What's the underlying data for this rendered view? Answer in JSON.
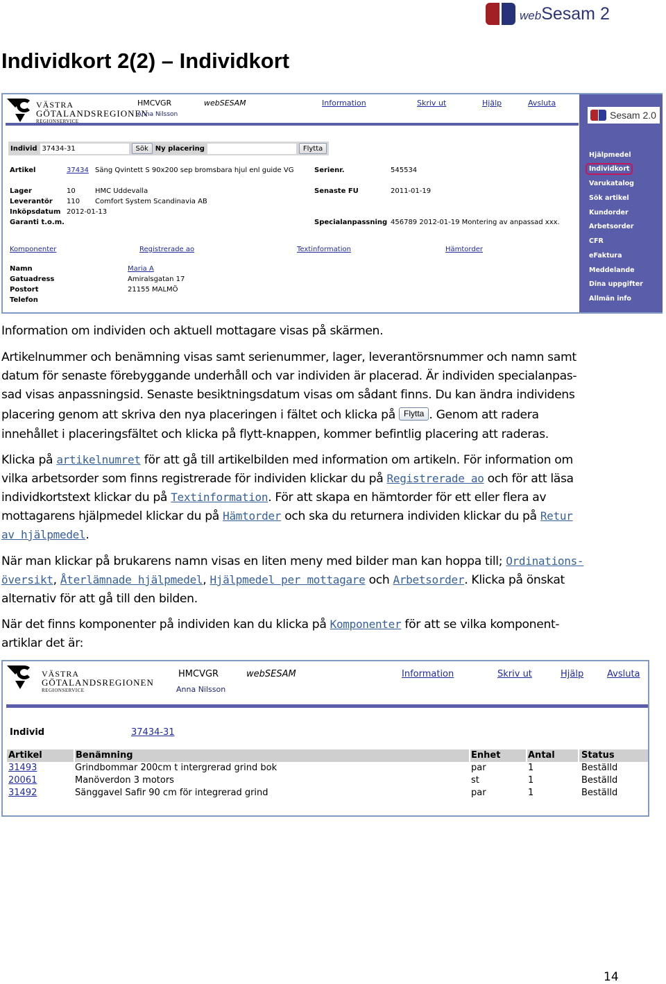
{
  "brand": {
    "prefix": "web",
    "name": "Sesam 2"
  },
  "page_title": "Individkort 2(2) – Individkort",
  "screen1": {
    "logo": {
      "line1": "VÄSTRA",
      "line2": "GÖTALANDSREGIONEN",
      "line3": "REGIONSERVICE"
    },
    "header": {
      "org": "HMCVGR",
      "user": "Anna Nilsson",
      "app": "webSESAM"
    },
    "nav": [
      "Information",
      "Skriv ut",
      "Hjälp",
      "Avsluta"
    ],
    "sesam_badge": "Sesam 2.0",
    "sidebar": [
      {
        "label": "Hjälpmedel",
        "active": false
      },
      {
        "label": "Individkort",
        "active": true
      },
      {
        "label": "Varukatalog",
        "active": false
      },
      {
        "label": "Sök artikel",
        "active": false
      },
      {
        "label": "Kundorder",
        "active": false
      },
      {
        "label": "Arbetsorder",
        "active": false
      },
      {
        "label": "CFR",
        "active": false
      },
      {
        "label": "eFaktura",
        "active": false
      },
      {
        "label": "Meddelande",
        "active": false
      },
      {
        "label": "Dina uppgifter",
        "active": false
      },
      {
        "label": "Allmän info",
        "active": false
      }
    ],
    "search": {
      "individ_label": "Individ",
      "individ_value": "37434-31",
      "search_button": "Sök",
      "placement_label": "Ny placering",
      "placement_value": "",
      "move_button": "Flytta"
    },
    "article": {
      "label": "Artikel",
      "number": "37434",
      "name": "Säng Qvintett S 90x200 sep bromsbara hjul enl guide VG"
    },
    "serial": {
      "label": "Serienr.",
      "value": "545534"
    },
    "storage": {
      "label": "Lager",
      "code": "10",
      "name": "HMC Uddevalla"
    },
    "supplier": {
      "label": "Leverantör",
      "code": "110",
      "name": "Comfort System Scandinavia AB"
    },
    "purchase_date": {
      "label": "Inköpsdatum",
      "value": "2012-01-13"
    },
    "warranty": {
      "label": "Garanti t.o.m.",
      "value": ""
    },
    "last_fu": {
      "label": "Senaste FU",
      "value": "2011-01-19"
    },
    "special": {
      "label": "Specialanpassning",
      "value": "456789  2012-01-19 Montering av anpassad xxx."
    },
    "links": [
      "Komponenter",
      "Registrerade ao",
      "Textinformation",
      "Hämtorder"
    ],
    "recipient": {
      "name_label": "Namn",
      "name_value": "Maria A",
      "street_label": "Gatuadress",
      "street_value": "Amiralsgatan 17",
      "city_label": "Postort",
      "city_value": "21155 MALMÖ",
      "phone_label": "Telefon",
      "phone_value": ""
    }
  },
  "body": {
    "p1": "Information om individen och aktuell mottagare visas på skärmen.",
    "p2_l1": "Artikelnummer och benämning visas samt serienummer, lager, leverantörsnummer och namn samt",
    "p2_l2": "datum för senaste förebyggande underhåll och var individen är placerad. Är individen specialanpas-",
    "p2_l3": "sad visas anpassningsid. Senaste besiktningsdatum visas om sådant finns. Du kan ändra individens",
    "p2_l4a": "placering genom att skriva den nya placeringen i fältet och klicka på ",
    "p2_btn": "Flytta",
    "p2_l4b": ". Genom att radera",
    "p2_l5": "innehållet i placeringsfältet och klicka på flytt-knappen, kommer befintlig placering att raderas.",
    "p3_l1a": "Klicka på ",
    "p3_link_article": "artikelnumret",
    "p3_l1b": " för att gå till artikelbilden med information om artikeln. För information om",
    "p3_l2a": "vilka arbetsorder som finns registrerade för individen klickar du på ",
    "p3_link_ao": "Registrerade ao",
    "p3_l2b": " och för att läsa",
    "p3_l3a": "individkortstext klickar du på ",
    "p3_link_text": "Textinformation",
    "p3_l3b": ". För att skapa en hämtorder för ett eller flera av",
    "p3_l4a": "mottagarens hjälpmedel klickar du på ",
    "p3_link_pickup": "Hämtorder",
    "p3_l4b": " och ska du returnera individen klickar du på ",
    "p3_link_return1": "Retur",
    "p3_link_return2": "av hjälpmedel",
    "p3_l5b": ".",
    "p4_l1a": "När man klickar på brukarens namn visas en liten meny med bilder man kan hoppa till; ",
    "p4_link_ord1": "Ordinations-",
    "p4_link_ord2": "översikt",
    "p4_sep1": ", ",
    "p4_link_returned": "Återlämnade hjälpmedel",
    "p4_sep2": ", ",
    "p4_link_per": "Hjälpmedel per mottagare",
    "p4_and": " och ",
    "p4_link_ao": "Arbetsorder",
    "p4_l2b": ". Klicka på önskat",
    "p4_l3": "alternativ för att gå till den bilden.",
    "p5_l1a": "När det finns komponenter på individen kan du klicka på ",
    "p5_link": "Komponenter",
    "p5_l1b": " för att se vilka komponent-",
    "p5_l2": "artiklar det är:"
  },
  "screen2": {
    "logo": {
      "line1": "VÄSTRA",
      "line2": "GÖTALANDSREGIONEN",
      "line3": "REGIONSERVICE"
    },
    "header": {
      "org": "HMCVGR",
      "user": "Anna Nilsson",
      "app": "webSESAM"
    },
    "nav": [
      "Information",
      "Skriv ut",
      "Hjälp",
      "Avsluta"
    ],
    "individ_label": "Individ",
    "individ_value": "37434-31",
    "table": {
      "columns": [
        "Artikel",
        "Benämning",
        "Enhet",
        "Antal",
        "Status"
      ],
      "rows": [
        [
          "31493",
          "Grindbommar 200cm t intergrerad grind bok",
          "par",
          "1",
          "Beställd"
        ],
        [
          "20061",
          "Manöverdon 3 motors",
          "st",
          "1",
          "Beställd"
        ],
        [
          "31492",
          "Sänggavel Safir 90 cm för integrerad grind",
          "par",
          "1",
          "Beställd"
        ]
      ]
    }
  },
  "page_number": "14"
}
